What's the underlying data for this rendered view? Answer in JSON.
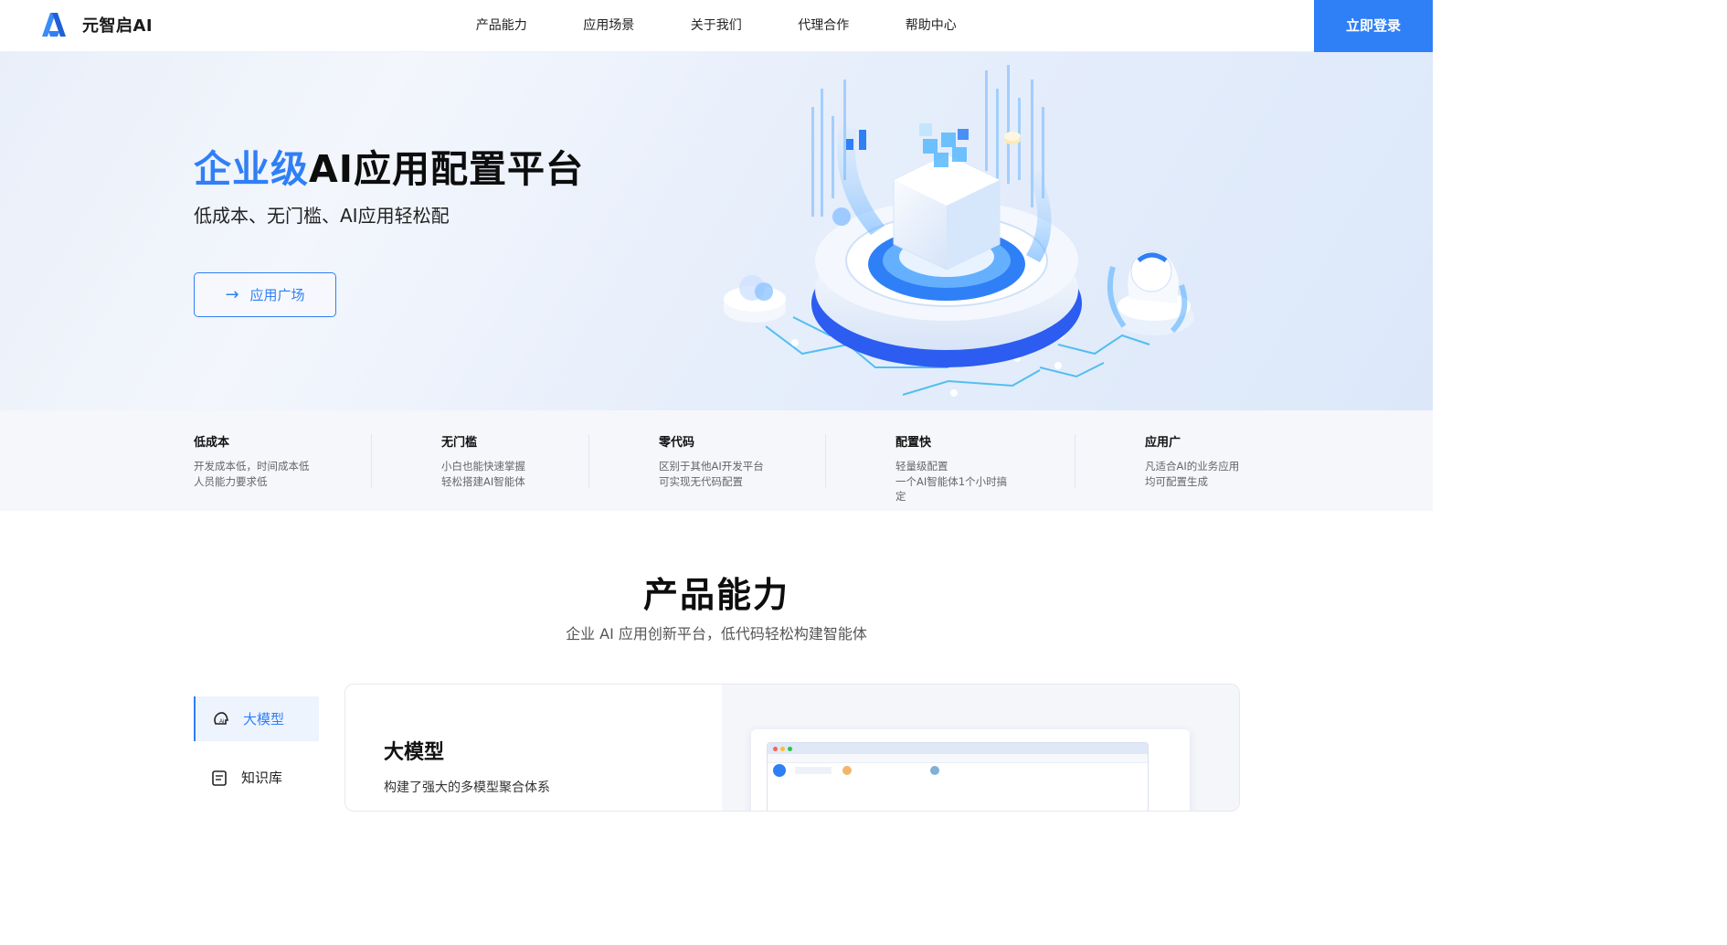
{
  "header": {
    "logo_text": "元智启AI",
    "nav": [
      "产品能力",
      "应用场景",
      "关于我们",
      "代理合作",
      "帮助中心"
    ],
    "login_label": "立即登录"
  },
  "hero": {
    "title_accent": "企业级",
    "title_rest": "AI应用配置平台",
    "subtitle": "低成本、无门槛、AI应用轻松配",
    "button_label": "应用广场"
  },
  "features": [
    {
      "title": "低成本",
      "lines": [
        "开发成本低，时间成本低",
        "人员能力要求低"
      ]
    },
    {
      "title": "无门槛",
      "lines": [
        "小白也能快速掌握",
        "轻松搭建AI智能体"
      ]
    },
    {
      "title": "零代码",
      "lines": [
        "区别于其他AI开发平台",
        "可实现无代码配置"
      ]
    },
    {
      "title": "配置快",
      "lines": [
        "轻量级配置",
        "一个AI智能体1个小时搞",
        "定"
      ]
    },
    {
      "title": "应用广",
      "lines": [
        "凡适合AI的业务应用",
        "均可配置生成"
      ]
    }
  ],
  "product": {
    "title": "产品能力",
    "subtitle": "企业 AI 应用创新平台，低代码轻松构建智能体",
    "tabs": [
      "大模型",
      "知识库"
    ],
    "active_tab": "大模型",
    "card_title": "大模型",
    "card_desc": "构建了强大的多模型聚合体系"
  },
  "colors": {
    "accent": "#2f7ff7",
    "hero_bg": "#e6eefb",
    "features_bg": "#f5f7fb"
  },
  "icons": {
    "logo": "triangle-a-logo-icon",
    "hero_button": "arrow-right-icon",
    "tab_model": "ai-head-icon",
    "tab_kb": "book-icon"
  }
}
